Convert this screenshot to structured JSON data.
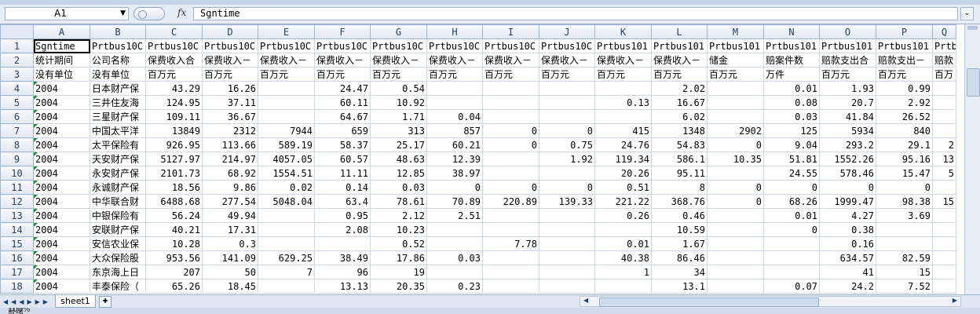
{
  "formula_bar": {
    "name_box": "A1",
    "fx_label": "fx",
    "formula": "Sgntime"
  },
  "columns": [
    "A",
    "B",
    "C",
    "D",
    "E",
    "F",
    "G",
    "H",
    "I",
    "J",
    "K",
    "L",
    "M",
    "N",
    "O",
    "P",
    "Q"
  ],
  "rows": [
    [
      "Sgntime",
      "Prtbus10C",
      "Prtbus10C",
      "Prtbus10C",
      "Prtbus10C",
      "Prtbus10C",
      "Prtbus10C",
      "Prtbus10C",
      "Prtbus10C",
      "Prtbus10C",
      "Prtbus101",
      "Prtbus101",
      "Prtbus101",
      "Prtbus101",
      "Prtbus101",
      "Prtbus101",
      "Prtb"
    ],
    [
      "统计期间",
      "公司名称",
      "保费收入合",
      "保费收入－",
      "保费收入－",
      "保费收入－",
      "保费收入－",
      "保费收入－",
      "保费收入－",
      "保费收入－",
      "保费收入－",
      "保费收入－",
      "储金",
      "赔案件数",
      "赔款支出合",
      "赔款支出－",
      "赔款"
    ],
    [
      "没有单位",
      "没有单位",
      "百万元",
      "百万元",
      "百万元",
      "百万元",
      "百万元",
      "百万元",
      "百万元",
      "百万元",
      "百万元",
      "百万元",
      "百万元",
      "万件",
      "百万元",
      "百万元",
      "百万"
    ],
    [
      "2004",
      "日本财产保",
      "43.29",
      "16.26",
      "",
      "24.47",
      "0.54",
      "",
      "",
      "",
      "",
      "2.02",
      "",
      "0.01",
      "1.93",
      "0.99",
      ""
    ],
    [
      "2004",
      "三井住友海",
      "124.95",
      "37.11",
      "",
      "60.11",
      "10.92",
      "",
      "",
      "",
      "0.13",
      "16.67",
      "",
      "0.08",
      "20.7",
      "2.92",
      ""
    ],
    [
      "2004",
      "三星财产保",
      "109.11",
      "36.67",
      "",
      "64.67",
      "1.71",
      "0.04",
      "",
      "",
      "",
      "6.02",
      "",
      "0.03",
      "41.84",
      "26.52",
      ""
    ],
    [
      "2004",
      "中国太平洋",
      "13849",
      "2312",
      "7944",
      "659",
      "313",
      "857",
      "0",
      "0",
      "415",
      "1348",
      "2902",
      "125",
      "5934",
      "840",
      ""
    ],
    [
      "2004",
      "太平保险有",
      "926.95",
      "113.66",
      "589.19",
      "58.37",
      "25.17",
      "60.21",
      "0",
      "0.75",
      "24.76",
      "54.83",
      "0",
      "9.04",
      "293.2",
      "29.1",
      "2"
    ],
    [
      "2004",
      "天安财产保",
      "5127.97",
      "214.97",
      "4057.05",
      "60.57",
      "48.63",
      "12.39",
      "",
      "1.92",
      "119.34",
      "586.1",
      "10.35",
      "51.81",
      "1552.26",
      "95.16",
      "13"
    ],
    [
      "2004",
      "永安财产保",
      "2101.73",
      "68.92",
      "1554.51",
      "11.11",
      "12.85",
      "38.97",
      "",
      "",
      "20.26",
      "95.11",
      "",
      "24.55",
      "578.46",
      "15.47",
      "5"
    ],
    [
      "2004",
      "永诚财产保",
      "18.56",
      "9.86",
      "0.02",
      "0.14",
      "0.03",
      "0",
      "0",
      "0",
      "0.51",
      "8",
      "0",
      "0",
      "0",
      "0",
      ""
    ],
    [
      "2004",
      "中华联合财",
      "6488.68",
      "277.54",
      "5048.04",
      "63.4",
      "78.61",
      "70.89",
      "220.89",
      "139.33",
      "221.22",
      "368.76",
      "0",
      "68.26",
      "1999.47",
      "98.38",
      "15"
    ],
    [
      "2004",
      "中银保险有",
      "56.24",
      "49.94",
      "",
      "0.95",
      "2.12",
      "2.51",
      "",
      "",
      "0.26",
      "0.46",
      "",
      "0.01",
      "4.27",
      "3.69",
      ""
    ],
    [
      "2004",
      "安联财产保",
      "40.21",
      "17.31",
      "",
      "2.08",
      "10.23",
      "",
      "",
      "",
      "",
      "10.59",
      "",
      "0",
      "0.38",
      "",
      ""
    ],
    [
      "2004",
      "安信农业保",
      "10.28",
      "0.3",
      "",
      "",
      "0.52",
      "",
      "7.78",
      "",
      "0.01",
      "1.67",
      "",
      "",
      "0.16",
      "",
      ""
    ],
    [
      "2004",
      "大众保险股",
      "953.56",
      "141.09",
      "629.25",
      "38.49",
      "17.86",
      "0.03",
      "",
      "",
      "40.38",
      "86.46",
      "",
      "",
      "634.57",
      "82.59",
      ""
    ],
    [
      "2004",
      "东京海上日",
      "207",
      "50",
      "7",
      "96",
      "19",
      "",
      "",
      "",
      "1",
      "34",
      "",
      "",
      "41",
      "15",
      ""
    ],
    [
      "2004",
      "丰泰保险（",
      "65.26",
      "18.45",
      "",
      "13.13",
      "20.35",
      "0.23",
      "",
      "",
      "",
      "13.1",
      "",
      "0.07",
      "24.2",
      "7.52",
      ""
    ]
  ],
  "sheet_tabs": [
    "sheet1"
  ],
  "status": {
    "ready": "就绪",
    "zoom": "100%"
  }
}
